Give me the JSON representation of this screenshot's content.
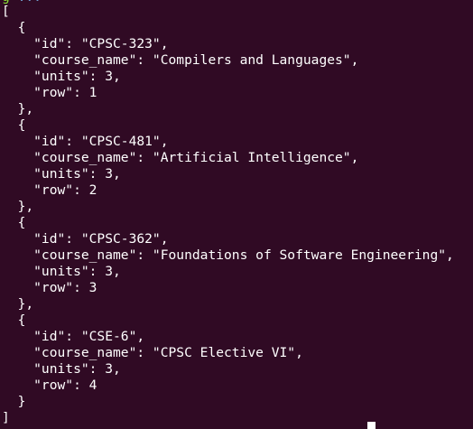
{
  "terminal": {
    "prompt_user": "g",
    "prompt_path": "...",
    "output_lines": [
      "[",
      "  {",
      "    \"id\": \"CPSC-323\",",
      "    \"course_name\": \"Compilers and Languages\",",
      "    \"units\": 3,",
      "    \"row\": 1",
      "  },",
      "  {",
      "    \"id\": \"CPSC-481\",",
      "    \"course_name\": \"Artificial Intelligence\",",
      "    \"units\": 3,",
      "    \"row\": 2",
      "  },",
      "  {",
      "    \"id\": \"CPSC-362\",",
      "    \"course_name\": \"Foundations of Software Engineering\",",
      "    \"units\": 3,",
      "    \"row\": 3",
      "  },",
      "  {",
      "    \"id\": \"CSE-6\",",
      "    \"course_name\": \"CPSC Elective VI\",",
      "    \"units\": 3,",
      "    \"row\": 4",
      "  }",
      "]"
    ]
  },
  "colors": {
    "background": "#300a24",
    "text": "#ffffff",
    "prompt_user": "#8ae234",
    "prompt_path": "#729fcf"
  }
}
